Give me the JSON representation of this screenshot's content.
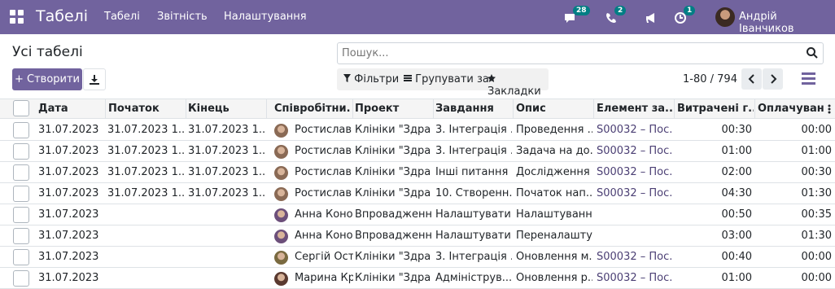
{
  "navbar": {
    "app_title": "Табелі",
    "menu": [
      "Табелі",
      "Звітність",
      "Налаштування"
    ],
    "chat_count": "28",
    "calls_count": "2",
    "activity_count": "1",
    "user_name": "Андрій Іванчиков"
  },
  "page": {
    "title": "Усі табелі",
    "search_placeholder": "Пошук...",
    "create_label": "+ Створити",
    "filters_label": "Фільтри",
    "group_by_label": "Групувати за",
    "favorites_label": "Закладки",
    "pager": "1-80 / 794"
  },
  "table": {
    "columns": [
      "Дата",
      "Початок",
      "Кінець",
      "Співробітни...",
      "Проект",
      "Завдання",
      "Опис",
      "Елемент за...",
      "Витрачені г...",
      "Оплачуван..."
    ],
    "rows": [
      {
        "date": "31.07.2023",
        "start": "31.07.2023 1...",
        "end": "31.07.2023 1...",
        "employee": "Ростислав Ц",
        "project": "Клініки \"Здра...",
        "task": "3. Інтеграція ...",
        "desc": "Проведення ...",
        "sale_item": "S00032 – Пос...",
        "spent": "00:30",
        "billable": "00:00"
      },
      {
        "date": "31.07.2023",
        "start": "31.07.2023 1...",
        "end": "31.07.2023 1...",
        "employee": "Ростислав Ц",
        "project": "Клініки \"Здра...",
        "task": "3. Інтеграція ...",
        "desc": "Задача на до...",
        "sale_item": "S00032 – Пос...",
        "spent": "01:00",
        "billable": "01:00"
      },
      {
        "date": "31.07.2023",
        "start": "31.07.2023 1...",
        "end": "31.07.2023 1...",
        "employee": "Ростислав Ц",
        "project": "Клініки \"Здра...",
        "task": "Інші питання",
        "desc": "Дослідження ...",
        "sale_item": "S00032 – Пос...",
        "spent": "02:00",
        "billable": "00:30"
      },
      {
        "date": "31.07.2023",
        "start": "31.07.2023 1...",
        "end": "31.07.2023 1...",
        "employee": "Ростислав Ц",
        "project": "Клініки \"Здра...",
        "task": "10. Створенн...",
        "desc": "Початок нап...",
        "sale_item": "S00032 – Пос...",
        "spent": "04:30",
        "billable": "01:30"
      },
      {
        "date": "31.07.2023",
        "start": "",
        "end": "",
        "employee": "Анна Коното",
        "project": "Впровадженн...",
        "task": "Налаштувати...",
        "desc": "Налаштуванн...",
        "sale_item": "",
        "spent": "00:50",
        "billable": "00:35"
      },
      {
        "date": "31.07.2023",
        "start": "",
        "end": "",
        "employee": "Анна Коното",
        "project": "Впровадженн...",
        "task": "Налаштувати...",
        "desc": "Переналашту...",
        "sale_item": "",
        "spent": "03:00",
        "billable": "01:30"
      },
      {
        "date": "31.07.2023",
        "start": "",
        "end": "",
        "employee": "Сергій Оста",
        "project": "Клініки \"Здра...",
        "task": "3. Інтеграція ...",
        "desc": "Оновлення м...",
        "sale_item": "S00032 – Пос...",
        "spent": "00:40",
        "billable": "00:00"
      },
      {
        "date": "31.07.2023",
        "start": "",
        "end": "",
        "employee": "Марина Кра",
        "project": "Клініки \"Здра...",
        "task": "Адмініструв...",
        "desc": "Оновлення р...",
        "sale_item": "S00032 – Пос...",
        "spent": "01:00",
        "billable": "00:00"
      }
    ]
  },
  "colors": {
    "brand": "#71639e",
    "badge": "#017e84",
    "link": "#4b3f74"
  }
}
